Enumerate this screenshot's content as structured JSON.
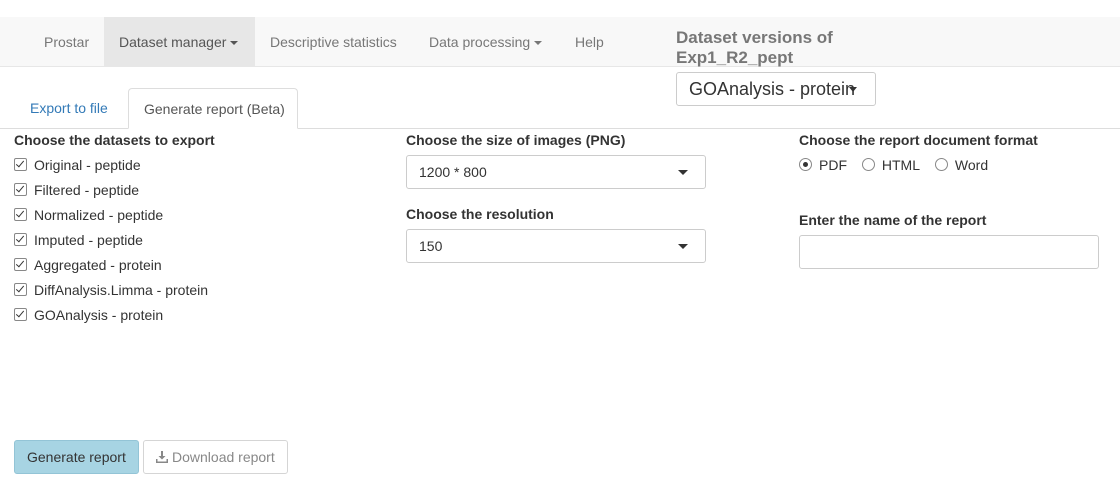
{
  "navbar": {
    "items": [
      {
        "label": "Prostar",
        "active": false,
        "dropdown": false
      },
      {
        "label": "Dataset manager",
        "active": true,
        "dropdown": true
      },
      {
        "label": "Descriptive statistics",
        "active": false,
        "dropdown": false
      },
      {
        "label": "Data processing",
        "active": false,
        "dropdown": true
      },
      {
        "label": "Help",
        "active": false,
        "dropdown": false
      }
    ],
    "versions_title_line1": "Dataset versions of",
    "versions_title_line2": "Exp1_R2_pept",
    "version_selected": "GOAnalysis - protein"
  },
  "tabs": [
    {
      "label": "Export to file",
      "active": false
    },
    {
      "label": "Generate report (Beta)",
      "active": true
    }
  ],
  "datasets": {
    "label": "Choose the datasets to export",
    "items": [
      {
        "label": "Original - peptide",
        "checked": true
      },
      {
        "label": "Filtered - peptide",
        "checked": true
      },
      {
        "label": "Normalized - peptide",
        "checked": true
      },
      {
        "label": "Imputed - peptide",
        "checked": true
      },
      {
        "label": "Aggregated - protein",
        "checked": true
      },
      {
        "label": "DiffAnalysis.Limma - protein",
        "checked": true
      },
      {
        "label": "GOAnalysis - protein",
        "checked": true
      }
    ]
  },
  "image_size": {
    "label": "Choose the size of images (PNG)",
    "value": "1200 * 800"
  },
  "resolution": {
    "label": "Choose the resolution",
    "value": "150"
  },
  "format": {
    "label": "Choose the report document format",
    "options": [
      {
        "label": "PDF",
        "selected": true
      },
      {
        "label": "HTML",
        "selected": false
      },
      {
        "label": "Word",
        "selected": false
      }
    ]
  },
  "report_name": {
    "label": "Enter the name of the report",
    "value": ""
  },
  "buttons": {
    "generate": "Generate report",
    "download": "Download report"
  },
  "colors": {
    "navbar_bg": "#f8f8f8",
    "active_nav_bg": "#e7e7e7",
    "link": "#337ab7",
    "generate_button_bg": "#a7d4e3"
  },
  "icons": {
    "download": "download-icon"
  }
}
